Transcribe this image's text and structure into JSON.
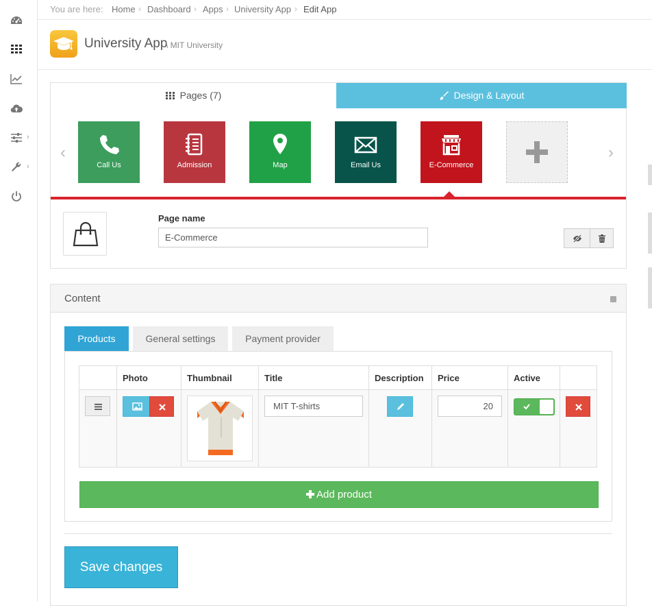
{
  "breadcrumb": {
    "prefix": "You are here:",
    "items": [
      "Home",
      "Dashboard",
      "Apps",
      "University App",
      "Edit App"
    ]
  },
  "header": {
    "title": "University App",
    "subtitle": "\\ MIT University"
  },
  "page_tabs": {
    "pages_label": "Pages (7)",
    "design_label": "Design & Layout"
  },
  "tiles": [
    {
      "label": "Call Us",
      "color": "#3c9d5d",
      "icon": "phone-icon"
    },
    {
      "label": "Admission",
      "color": "#b8373f",
      "icon": "notebook-icon"
    },
    {
      "label": "Map",
      "color": "#21a147",
      "icon": "map-pin-icon"
    },
    {
      "label": "Email Us",
      "color": "#08544a",
      "icon": "envelope-icon"
    },
    {
      "label": "E-Commerce",
      "color": "#c2141c",
      "icon": "store-icon"
    }
  ],
  "page_form": {
    "label": "Page name",
    "value": "E-Commerce"
  },
  "content": {
    "title": "Content",
    "tabs": [
      "Products",
      "General settings",
      "Payment provider"
    ],
    "columns": [
      "",
      "Photo",
      "Thumbnail",
      "Title",
      "Description",
      "Price",
      "Active",
      ""
    ],
    "rows": [
      {
        "title": "MIT T-shirts",
        "price": "20",
        "active": true
      }
    ],
    "add_label": "Add product",
    "save_label": "Save changes"
  },
  "colors": {
    "accent": "#5bc0de",
    "primary_tab": "#2fa4d5",
    "success": "#5cb85c",
    "danger": "#e04b3c",
    "active_line": "#d9232d"
  }
}
